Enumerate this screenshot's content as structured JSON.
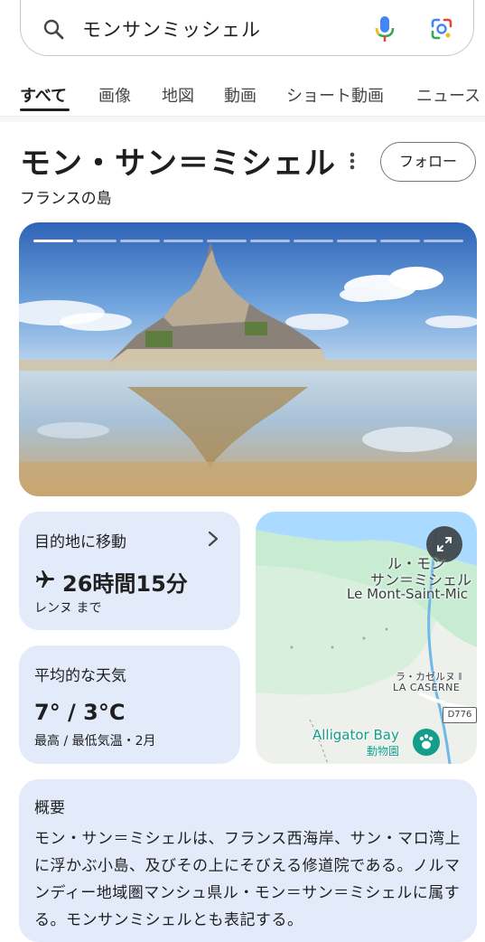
{
  "search": {
    "query": "モンサンミッシェル",
    "icons": [
      "search-icon",
      "mic-icon",
      "lens-icon"
    ]
  },
  "tabs": [
    {
      "label": "すべて",
      "active": true
    },
    {
      "label": "画像"
    },
    {
      "label": "地図"
    },
    {
      "label": "動画"
    },
    {
      "label": "ショート動画"
    },
    {
      "label": "ニュース"
    }
  ],
  "entity": {
    "title": "モン・サン＝ミシェル",
    "subtitle": "フランスの島",
    "follow_label": "フォロー"
  },
  "hero": {
    "slide_count": 10,
    "active_slide": 1
  },
  "destination": {
    "label": "目的地に移動",
    "duration": "26時間15分",
    "from": "レンヌ まで"
  },
  "weather": {
    "label": "平均的な天気",
    "temps": "7° / 3°C",
    "detail": "最高 / 最低気温・2月"
  },
  "map": {
    "place_jp_line1": "ル・モン",
    "place_jp_line2": "サン＝ミシェル",
    "place_fr": "Le Mont-Saint-Mic",
    "caserne_jp": "ラ・カゼルヌ",
    "caserne_fr": "LA CASERNE",
    "road": "D776",
    "poi_name": "Alligator Bay",
    "poi_type": "動物園"
  },
  "overview": {
    "heading": "概要",
    "body": "モン・サン＝ミシェルは、フランス西海岸、サン・マロ湾上に浮かぶ小島、及びその上にそびえる修道院である。ノルマンディー地域圏マンシュ県ル・モン＝サン＝ミシェルに属する。モンサンミシェルとも表記する。"
  },
  "colors": {
    "card_bg": "#e3ebfb",
    "map_green": "#c8ecd2",
    "map_water": "#aadaff",
    "poi_teal": "#129e8a"
  }
}
